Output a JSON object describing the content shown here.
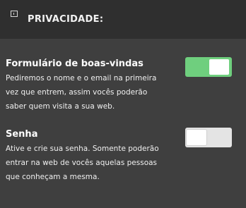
{
  "header": {
    "icon": "small-square-icon",
    "title": "PRIVACIDADE:"
  },
  "settings": [
    {
      "title": "Formulário de boas-vindas",
      "desc_lines": [
        "Pediremos o nome e o email na primeira",
        "vez que entrem, assim vocês poderão",
        "saber quem visita a sua web."
      ],
      "enabled": true
    },
    {
      "title": "Senha",
      "desc_lines": [
        "Ative e crie sua senha. Somente poderão",
        "entrar na web de vocês aquelas pessoas",
        "que conheçam a mesma."
      ],
      "enabled": false
    }
  ],
  "colors": {
    "background": "#3f3f3f",
    "header_background": "#2f2f2f",
    "toggle_on": "#6fcf7e",
    "toggle_off": "#e4e4e4"
  }
}
